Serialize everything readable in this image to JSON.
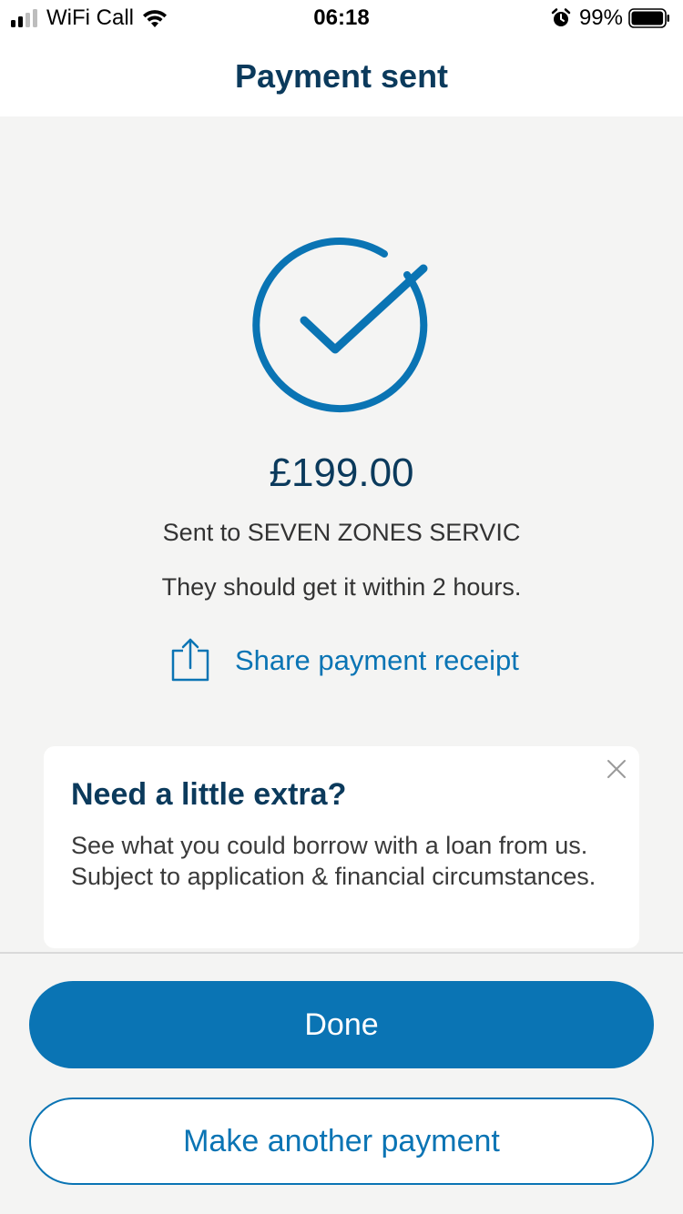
{
  "status_bar": {
    "carrier": "WiFi Call",
    "time": "06:18",
    "battery_percent": "99%",
    "battery_level": 0.99,
    "icons": [
      "signal-icon",
      "wifi-icon",
      "alarm-icon",
      "battery-icon"
    ]
  },
  "header": {
    "title": "Payment sent"
  },
  "confirmation": {
    "icon": "check-circle-icon",
    "amount": "£199.00",
    "recipient_text": "Sent to SEVEN ZONES SERVIC",
    "eta_text": "They should get it within 2 hours.",
    "share_label": "Share payment receipt",
    "share_icon": "share-icon"
  },
  "promo": {
    "title": "Need a little extra?",
    "body": "See what you could borrow with a loan from us. Subject to application & financial circumstances.",
    "close_icon": "close-icon"
  },
  "actions": {
    "done_label": "Done",
    "another_payment_label": "Make another payment"
  },
  "colors": {
    "brand_blue": "#0a74b4",
    "navy_text": "#0b3a5c",
    "background": "#f4f4f3"
  }
}
